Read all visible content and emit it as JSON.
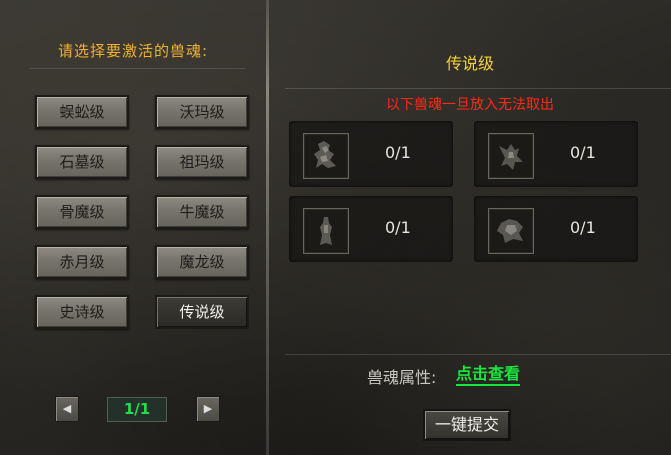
{
  "left_panel": {
    "title": "请选择要激活的兽魂:",
    "tiers": [
      {
        "label": "蜈蚣级"
      },
      {
        "label": "沃玛级"
      },
      {
        "label": "石墓级"
      },
      {
        "label": "祖玛级"
      },
      {
        "label": "骨魔级"
      },
      {
        "label": "牛魔级"
      },
      {
        "label": "赤月级"
      },
      {
        "label": "魔龙级"
      },
      {
        "label": "史诗级"
      },
      {
        "label": "传说级",
        "selected": true
      }
    ],
    "pager": {
      "prev_icon": "left-triangle-icon",
      "page_text": "1/1",
      "next_icon": "right-triangle-icon"
    }
  },
  "right_panel": {
    "title": "传说级",
    "warning": "以下兽魂一旦放入无法取出",
    "slots": [
      {
        "icon": "beast-soul-icon",
        "count": "0/1"
      },
      {
        "icon": "beast-soul-icon",
        "count": "0/1"
      },
      {
        "icon": "beast-soul-icon",
        "count": "0/1"
      },
      {
        "icon": "beast-soul-icon",
        "count": "0/1"
      }
    ],
    "attribute_label": "兽魂属性:",
    "attribute_link": "点击查看",
    "submit_label": "一键提交"
  },
  "colors": {
    "title_orange": "#f0b030",
    "title_yellow": "#f2d23a",
    "warning_red": "#ff2a14",
    "link_green": "#18e63e"
  }
}
